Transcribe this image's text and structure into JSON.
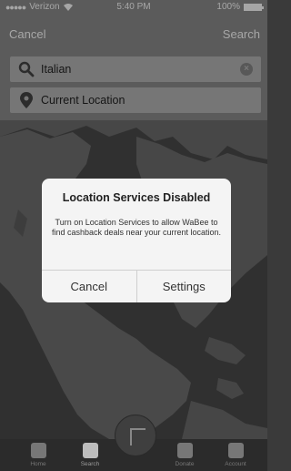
{
  "status_bar": {
    "carrier": "Verizon",
    "time": "5:40 PM",
    "battery": "100%"
  },
  "nav": {
    "cancel_label": "Cancel",
    "search_label": "Search"
  },
  "search": {
    "query": "Italian",
    "location": "Current Location"
  },
  "dialog": {
    "title": "Location Services Disabled",
    "message": "Turn on Location Services to allow WaBee to find cashback deals near your current location.",
    "cancel_label": "Cancel",
    "settings_label": "Settings"
  },
  "tab_bar": {
    "items": [
      {
        "label": "Home",
        "icon": "home-icon"
      },
      {
        "label": "Search",
        "icon": "search-tab-icon"
      },
      {
        "label": "Donate",
        "icon": "donate-icon"
      },
      {
        "label": "Account",
        "icon": "account-icon"
      }
    ],
    "active": "Search"
  },
  "colors": {
    "dialog_bg": "#f4f4f4",
    "tab_bar_bg": "#2b2b2b",
    "field_bg": "#b6b6b6"
  }
}
